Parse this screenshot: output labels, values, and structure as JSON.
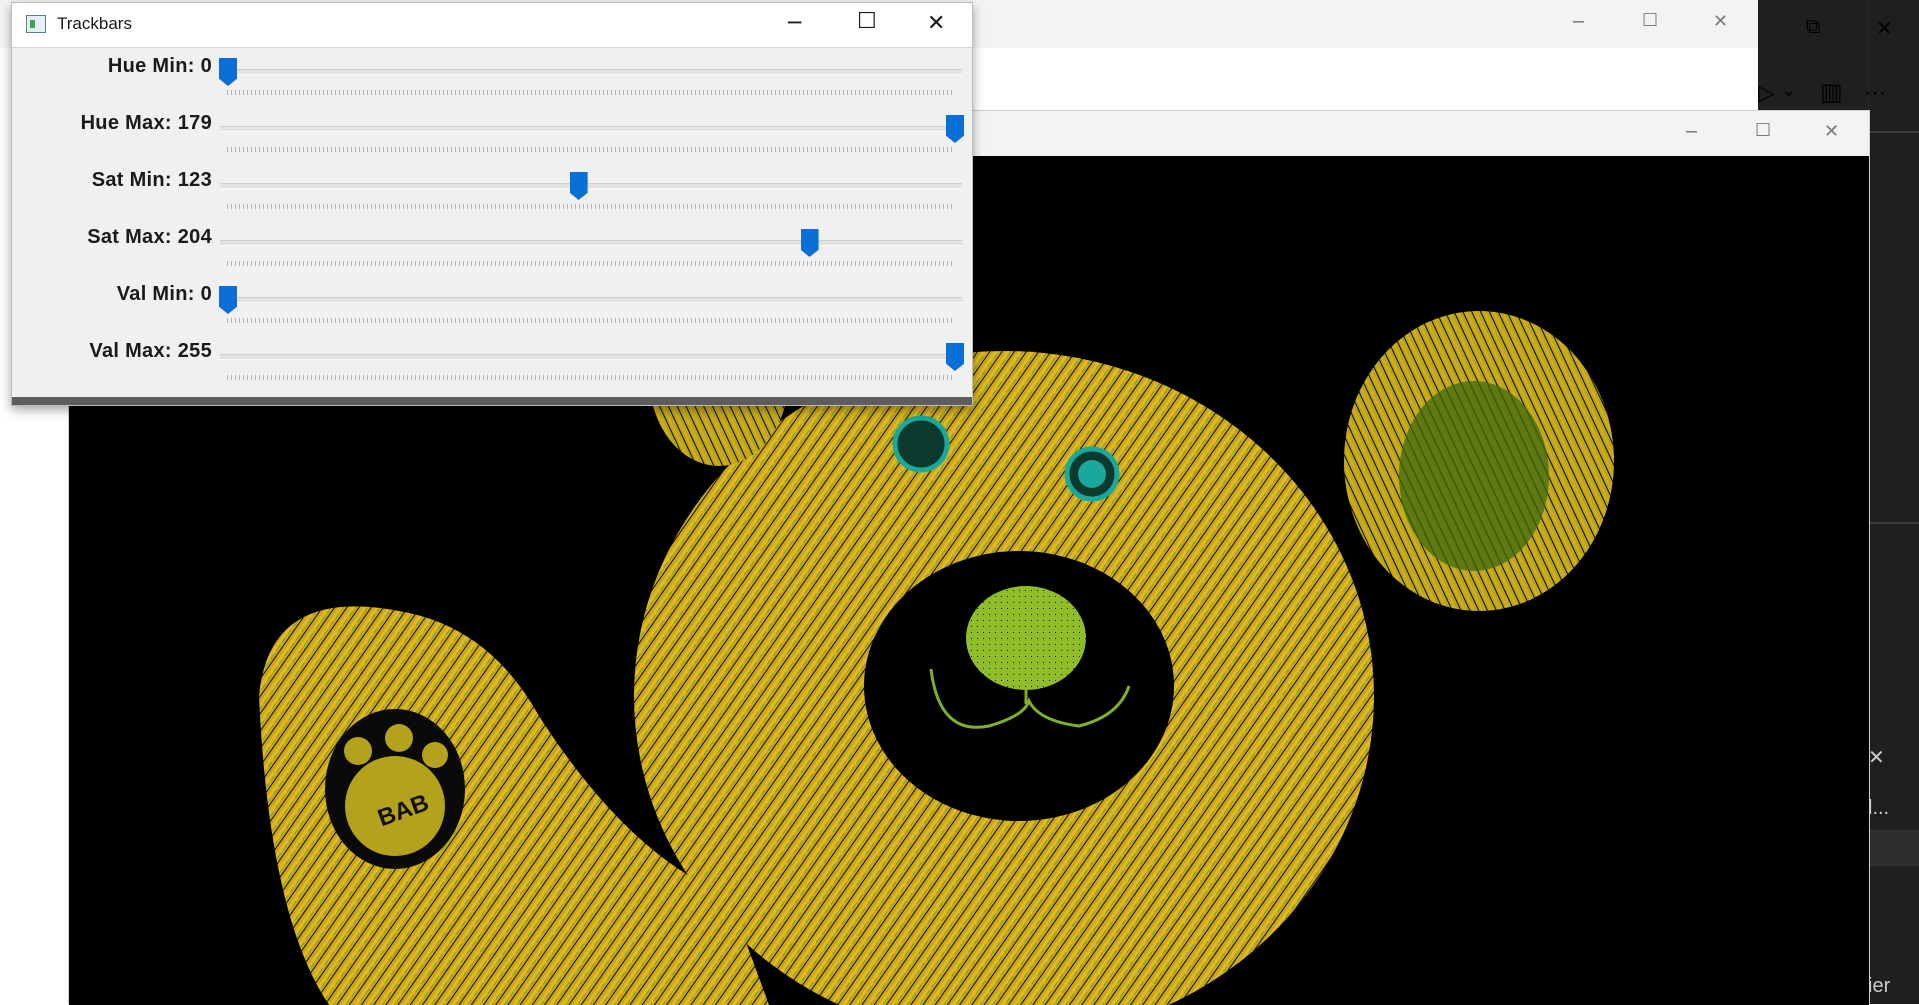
{
  "trackbars_window": {
    "title": "Trackbars",
    "controls": {
      "minimize": "─",
      "maximize": "☐",
      "close": "✕"
    },
    "sliders": [
      {
        "label": "Hue Min: 0",
        "name": "hue-min",
        "value": 0,
        "max": 179
      },
      {
        "label": "Hue Max: 179",
        "name": "hue-max",
        "value": 179,
        "max": 179
      },
      {
        "label": "Sat Min: 123",
        "name": "sat-min",
        "value": 123,
        "max": 255
      },
      {
        "label": "Sat Max: 204",
        "name": "sat-max",
        "value": 204,
        "max": 255
      },
      {
        "label": "Val Min: 0",
        "name": "val-min",
        "value": 0,
        "max": 255
      },
      {
        "label": "Val Max: 255",
        "name": "val-max",
        "value": 255,
        "max": 255
      }
    ]
  },
  "image_window": {
    "controls": {
      "minimize": "─",
      "maximize": "☐",
      "close": "✕"
    },
    "paw_text": "BAB"
  },
  "back_window": {
    "controls": {
      "minimize": "─",
      "maximize": "☐",
      "close": "✕"
    }
  },
  "ide": {
    "restore": "⧉",
    "close": "✕",
    "run": "▷",
    "run_dropdown": "⌄",
    "split": "▥",
    "more": "⋯",
    "panel_close": "✕",
    "truncated_label": "l...",
    "bottom_text": "ier"
  },
  "colors": {
    "accent": "#0a6fd6",
    "fur": "#d8b21a",
    "eye": "#1aa89c"
  }
}
